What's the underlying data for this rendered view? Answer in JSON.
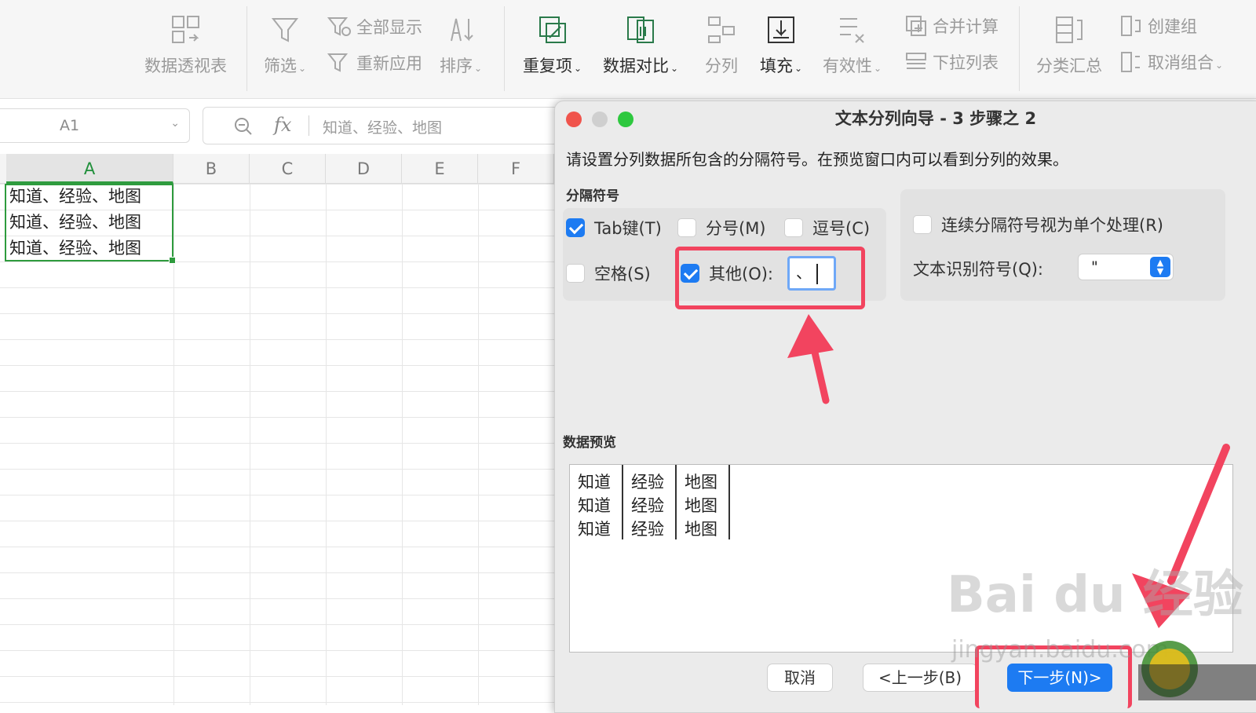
{
  "ribbon": {
    "pivot": "数据透视表",
    "filter": "筛选",
    "show_all": "全部显示",
    "reapply": "重新应用",
    "sort": "排序",
    "duplicates": "重复项",
    "compare": "数据对比",
    "split": "分列",
    "fill": "填充",
    "validity": "有效性",
    "merge_calc": "合并计算",
    "dropdown_list": "下拉列表",
    "subtotal": "分类汇总",
    "group": "创建组",
    "ungroup": "取消组合"
  },
  "namebox": {
    "ref": "A1"
  },
  "formula": {
    "fx": "fx",
    "text": "知道、经验、地图"
  },
  "sheet": {
    "columns": [
      "A",
      "B",
      "C",
      "D",
      "E",
      "F"
    ],
    "cells": [
      "知道、经验、地图",
      "知道、经验、地图",
      "知道、经验、地图"
    ]
  },
  "dialog": {
    "title": "文本分列向导 - 3 步骤之 2",
    "instruction": "请设置分列数据所包含的分隔符号。在预览窗口内可以看到分列的效果。",
    "delim_label": "分隔符号",
    "tab": "Tab键(T)",
    "semicolon": "分号(M)",
    "comma": "逗号(C)",
    "space": "空格(S)",
    "other": "其他(O):",
    "other_value": "、",
    "consecutive": "连续分隔符号视为单个处理(R)",
    "qualifier_label": "文本识别符号(Q):",
    "qualifier_value": "\"",
    "preview_label": "数据预览",
    "preview_rows": [
      [
        "知道",
        "经验",
        "地图"
      ],
      [
        "知道",
        "经验",
        "地图"
      ],
      [
        "知道",
        "经验",
        "地图"
      ]
    ],
    "cancel": "取消",
    "back": "<上一步(B)",
    "next": "下一步(N)>",
    "checked": {
      "tab": true,
      "semicolon": false,
      "comma": false,
      "space": false,
      "other": true,
      "consecutive": false
    }
  },
  "watermark": {
    "main": "Bai du 经验",
    "sub": "jingyan.baidu.com"
  },
  "colors": {
    "accent": "#1d7bf2",
    "selection": "#2e9b3d",
    "annotation": "#f2445f"
  }
}
